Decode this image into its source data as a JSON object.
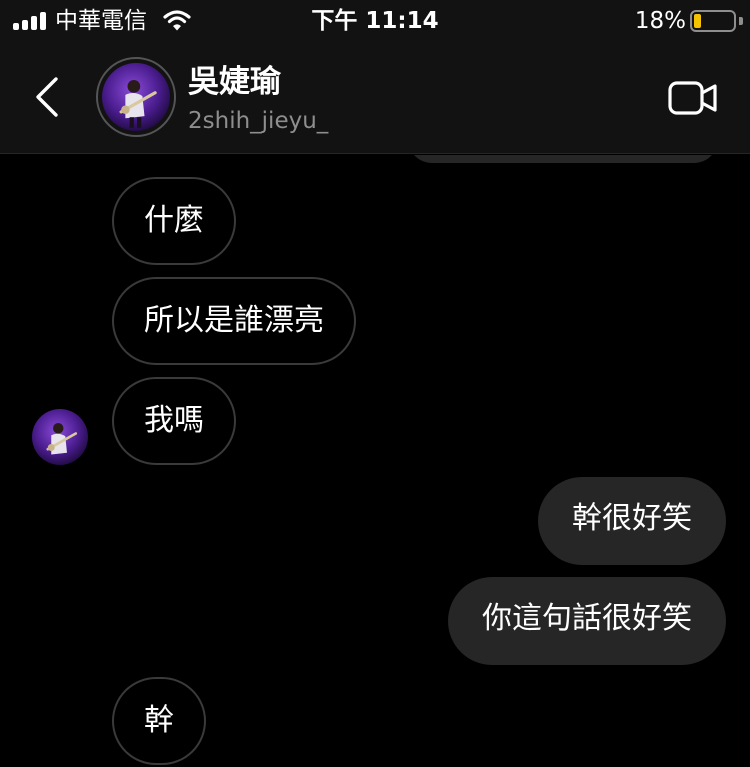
{
  "status_bar": {
    "carrier": "中華電信",
    "time": "下午 11:14",
    "battery_percent": "18%",
    "battery_level": 0.18,
    "signal_bars": 4,
    "wifi_icon": "wifi-icon"
  },
  "header": {
    "name": "吳婕瑜",
    "username": "2shih_jieyu_",
    "back_icon": "chevron-left-icon",
    "video_icon": "video-camera-icon"
  },
  "messages": [
    {
      "side": "incoming",
      "text": "什麼"
    },
    {
      "side": "incoming",
      "text": "所以是誰漂亮"
    },
    {
      "side": "incoming",
      "text": "我嗎"
    },
    {
      "side": "outgoing",
      "text": "幹很好笑"
    },
    {
      "side": "outgoing",
      "text": "你這句話很好笑"
    },
    {
      "side": "incoming",
      "text": "幹"
    }
  ],
  "colors": {
    "background": "#000000",
    "header_bg": "#121212",
    "outgoing_bubble": "#262626",
    "incoming_border": "#3a3a3a",
    "secondary_text": "#8e8e8e",
    "battery_fill": "#f5c400"
  }
}
